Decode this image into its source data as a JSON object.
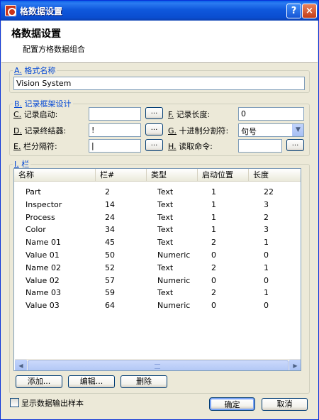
{
  "window": {
    "title": "格数据设置",
    "help_label": "?",
    "close_label": "×"
  },
  "header": {
    "title": "格数据设置",
    "subtitle": "配置方格数据组合"
  },
  "format_group": {
    "key": "A.",
    "label": "格式名称",
    "name_value": "Vision System"
  },
  "record_group": {
    "key": "B.",
    "label": "记录框架设计",
    "record_start": {
      "key": "C.",
      "label": "记录启动:",
      "value": ""
    },
    "record_end": {
      "key": "D.",
      "label": "记录终结器:",
      "value": "!"
    },
    "field_separator": {
      "key": "E.",
      "label": "栏分隔符:",
      "value": "|"
    },
    "record_length": {
      "key": "F.",
      "label": "记录长度:",
      "value": "0"
    },
    "decimal_separator": {
      "key": "G.",
      "label": "十进制分割符:",
      "value": "句号"
    },
    "read_command": {
      "key": "H.",
      "label": "读取命令:",
      "value": ""
    },
    "browse_label": "..."
  },
  "columns_group": {
    "key": "I.",
    "label": "栏",
    "headers": [
      "名称",
      "栏#",
      "类型",
      "启动位置",
      "长度"
    ],
    "rows": [
      [
        "Part",
        "2",
        "Text",
        "1",
        "22"
      ],
      [
        "Inspector",
        "14",
        "Text",
        "1",
        "3"
      ],
      [
        "Process",
        "24",
        "Text",
        "1",
        "2"
      ],
      [
        "Color",
        "34",
        "Text",
        "1",
        "3"
      ],
      [
        "Name 01",
        "45",
        "Text",
        "2",
        "1"
      ],
      [
        "Value 01",
        "50",
        "Numeric",
        "0",
        "0"
      ],
      [
        "Name 02",
        "52",
        "Text",
        "2",
        "1"
      ],
      [
        "Value 02",
        "57",
        "Numeric",
        "0",
        "0"
      ],
      [
        "Name 03",
        "59",
        "Text",
        "2",
        "1"
      ],
      [
        "Value 03",
        "64",
        "Numeric",
        "0",
        "0"
      ]
    ],
    "add_label": "添加...",
    "edit_label": "编辑...",
    "delete_label": "删除"
  },
  "footer": {
    "show_sample_label": "显示数据输出样本",
    "ok_label": "确定",
    "cancel_label": "取消"
  },
  "colors": {
    "titlebar": "#0A4DD0",
    "window_bg": "#ECE9D8",
    "group_label": "#0046D5"
  },
  "icons": {
    "app": "app-logo-icon",
    "help": "help-icon",
    "close": "close-icon",
    "combo": "chevron-down-icon"
  }
}
